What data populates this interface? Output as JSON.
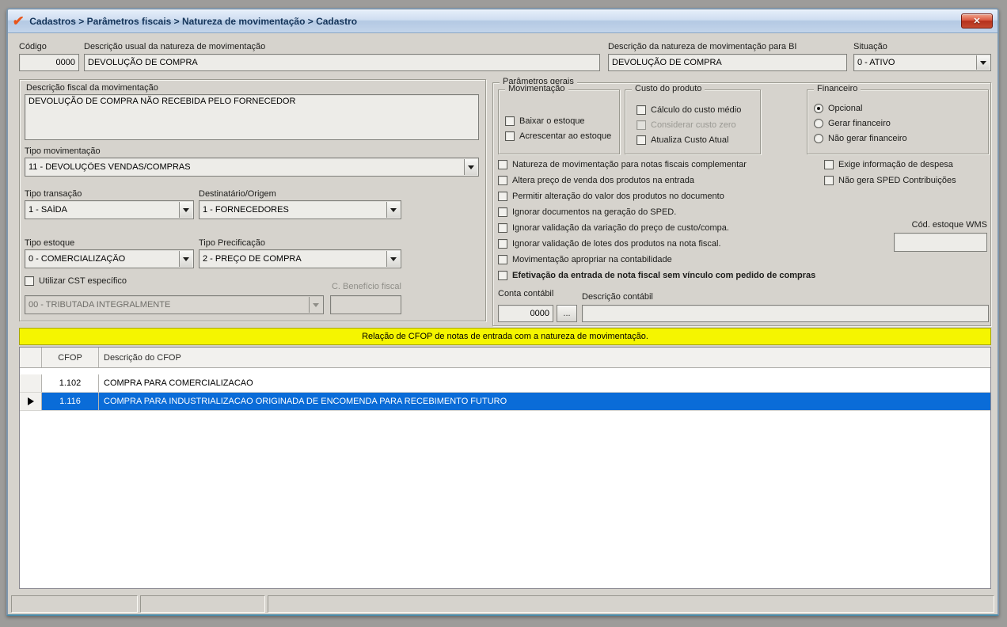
{
  "window": {
    "title": "Cadastros > Parâmetros fiscais > Natureza de movimentação > Cadastro",
    "icon": "✔",
    "close": "✕"
  },
  "header": {
    "codigo_label": "Código",
    "codigo_value": "0000",
    "desc_usual_label": "Descrição usual da natureza de movimentação",
    "desc_usual_value": "DEVOLUÇÃO DE COMPRA",
    "desc_bi_label": "Descrição da natureza de movimentação para BI",
    "desc_bi_value": "DEVOLUÇÃO DE COMPRA",
    "situacao_label": "Situação",
    "situacao_value": "0 - ATIVO"
  },
  "fiscal_panel": {
    "desc_fiscal_label": "Descrição fiscal da movimentação",
    "desc_fiscal_value": "DEVOLUÇÃO DE COMPRA NÃO RECEBIDA PELO FORNECEDOR",
    "tipo_mov_label": "Tipo movimentação",
    "tipo_mov_value": "11 - DEVOLUÇÕES VENDAS/COMPRAS",
    "tipo_trans_label": "Tipo transação",
    "tipo_trans_value": "1 - SAÍDA",
    "destinatario_label": "Destinatário/Origem",
    "destinatario_value": "1 - FORNECEDORES",
    "tipo_estoque_label": "Tipo estoque",
    "tipo_estoque_value": "0 - COMERCIALIZAÇÃO",
    "tipo_precif_label": "Tipo Precificação",
    "tipo_precif_value": "2 - PREÇO DE COMPRA",
    "utilizar_cst_label": "Utilizar CST específico",
    "utilizar_cst_checked": false,
    "beneficio_label": "C. Benefício fiscal",
    "beneficio_value": "",
    "cst_value": "00 - TRIBUTADA INTEGRALMENTE"
  },
  "parametros": {
    "title": "Parâmetros gerais",
    "movimentacao": {
      "title": "Movimentação",
      "checkboxes": [
        {
          "label": "Baixar o estoque",
          "checked": false
        },
        {
          "label": "Acrescentar ao estoque",
          "checked": false
        }
      ]
    },
    "custo": {
      "title": "Custo do produto",
      "checkboxes": [
        {
          "label": "Cálculo do custo médio",
          "checked": false
        },
        {
          "label": "Considerar custo zero",
          "checked": false,
          "disabled": true
        },
        {
          "label": "Atualiza Custo Atual",
          "checked": false
        }
      ]
    },
    "financeiro": {
      "title": "Financeiro",
      "options": [
        {
          "label": "Opcional",
          "selected": true
        },
        {
          "label": "Gerar financeiro",
          "selected": false
        },
        {
          "label": "Não gerar financeiro",
          "selected": false
        }
      ]
    },
    "flags": [
      {
        "label": "Natureza de movimentação para notas fiscais complementar",
        "checked": false
      },
      {
        "label": "Altera preço de venda dos produtos na entrada",
        "checked": false
      },
      {
        "label": "Permitir alteração do valor dos produtos no documento",
        "checked": false
      },
      {
        "label": "Ignorar documentos na geração do SPED.",
        "checked": false
      },
      {
        "label": "Ignorar validação da variação do preço de custo/compa.",
        "checked": false
      },
      {
        "label": "Ignorar validação de lotes dos produtos na nota fiscal.",
        "checked": false
      },
      {
        "label": "Movimentação apropriar na contabilidade",
        "checked": false
      },
      {
        "label": "Efetivação da entrada de nota fiscal sem vínculo com pedido de compras",
        "checked": false,
        "bold": true
      }
    ],
    "side_flags": [
      {
        "label": "Exige informação de despesa",
        "checked": false
      },
      {
        "label": "Não gera SPED Contribuições",
        "checked": false
      }
    ],
    "wms_label": "Cód. estoque WMS",
    "wms_value": "",
    "conta_label": "Conta contábil",
    "conta_value": "0000",
    "browse_label": "...",
    "desc_contabil_label": "Descrição contábil",
    "desc_contabil_value": ""
  },
  "cfop": {
    "banner": "Relação de CFOP de notas de entrada com a natureza de movimentação.",
    "columns": [
      "CFOP",
      "Descrição do CFOP"
    ],
    "rows": [
      {
        "cfop": "1.102",
        "descricao": "COMPRA PARA COMERCIALIZACAO",
        "selected": false
      },
      {
        "cfop": "1.116",
        "descricao": "COMPRA PARA INDUSTRIALIZACAO ORIGINADA DE ENCOMENDA PARA RECEBIMENTO FUTURO",
        "selected": true
      }
    ]
  },
  "status_bar": {
    "panels": [
      "",
      "",
      ""
    ]
  },
  "colors": {
    "selection_blue": "#0a6cd8",
    "banner_yellow": "#f5f500",
    "close_red": "#c3392a",
    "titlebar_blue": "#c2d4ea",
    "check_orange": "#e8551a",
    "window_gray": "#d6d3cd"
  }
}
